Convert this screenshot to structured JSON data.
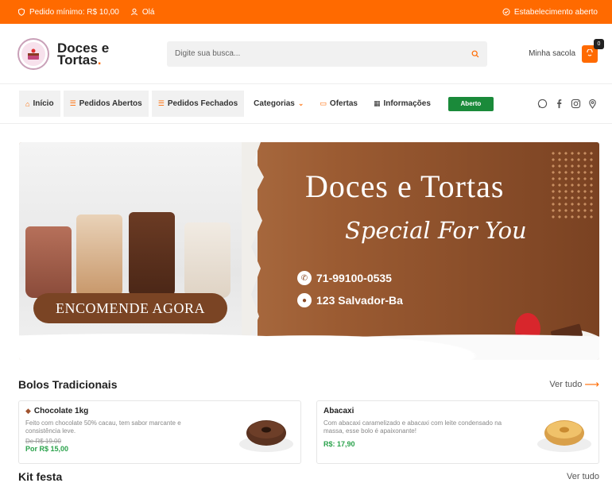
{
  "topbar": {
    "min_order": "Pedido mínimo: R$ 10,00",
    "greeting": "Olá",
    "status": "Estabelecimento aberto"
  },
  "header": {
    "logo_line1": "Doces e",
    "logo_line2": "Tortas",
    "logo_dot": ".",
    "search_placeholder": "Digite sua busca...",
    "bag_label": "Minha sacola",
    "bag_count": "0"
  },
  "nav": {
    "items": [
      {
        "label": "Início"
      },
      {
        "label": "Pedidos Abertos"
      },
      {
        "label": "Pedidos Fechados"
      },
      {
        "label": "Categorias"
      },
      {
        "label": "Ofertas"
      },
      {
        "label": "Informações"
      }
    ],
    "status_badge": "Aberto",
    "social": [
      "whatsapp-icon",
      "facebook-icon",
      "instagram-icon",
      "location-icon"
    ]
  },
  "banner": {
    "title": "Doces e Tortas",
    "subtitle": "Special For You",
    "phone": "71-99100-0535",
    "address": "123 Salvador-Ba",
    "cta": "ENCOMENDE AGORA"
  },
  "sections": [
    {
      "title": "Bolos Tradicionais",
      "link": "Ver tudo",
      "products": [
        {
          "name": "Chocolate 1kg",
          "desc": "Feito com chocolate 50% cacau, tem sabor marcante e consistência leve.",
          "old_price": "De R$ 19,00",
          "price": "Por R$ 15,00"
        },
        {
          "name": "Abacaxi",
          "desc": "Com abacaxi caramelizado e abacaxi com leite condensado na massa, esse bolo é apaixonante!",
          "old_price": "",
          "price": "R$: 17,90"
        }
      ]
    },
    {
      "title": "Kit festa",
      "link": "Ver tudo"
    }
  ],
  "colors": {
    "accent": "#ff6a00",
    "open_green": "#1a8a3a",
    "price_green": "#2aa24b",
    "banner_brown": "#9b5b32"
  }
}
